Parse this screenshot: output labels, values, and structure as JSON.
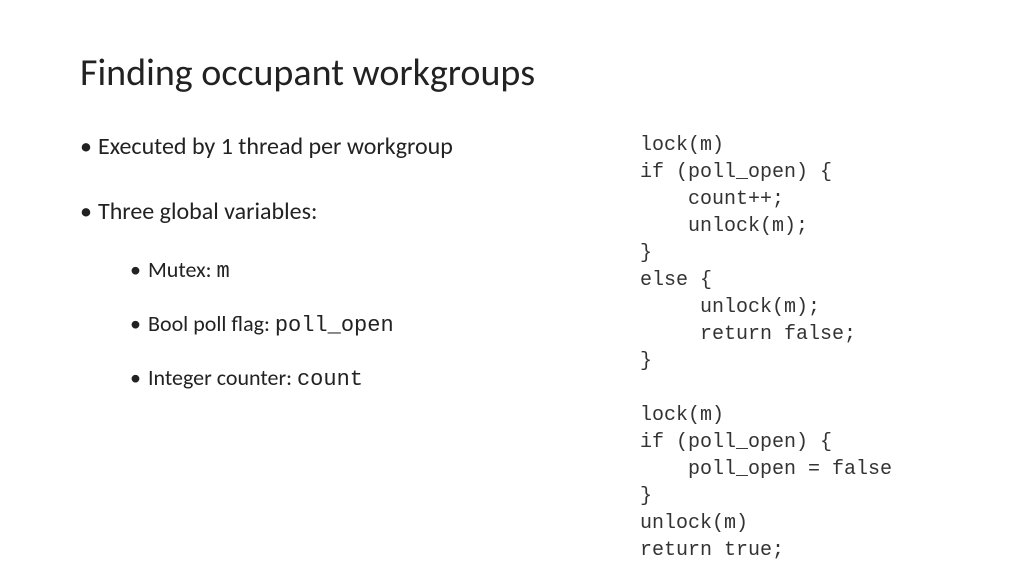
{
  "title": "Finding occupant workgroups",
  "bullets": {
    "b1": "Executed by 1 thread per workgroup",
    "b2": "Three global variables:",
    "sub1_prefix": "Mutex: ",
    "sub1_code": "m",
    "sub2_prefix": "Bool poll flag: ",
    "sub2_code": "poll_open",
    "sub3_prefix": "Integer counter: ",
    "sub3_code": "count"
  },
  "code": {
    "l01": "lock(m)",
    "l02": "if (poll_open) {",
    "l03": "    count++;",
    "l04": "    unlock(m);",
    "l05": "}",
    "l06": "else {",
    "l07": "     unlock(m);",
    "l08": "     return false;",
    "l09": "}",
    "l10": "",
    "l11": "lock(m)",
    "l12": "if (poll_open) {",
    "l13": "    poll_open = false",
    "l14": "}",
    "l15": "unlock(m)",
    "l16": "return true;"
  }
}
